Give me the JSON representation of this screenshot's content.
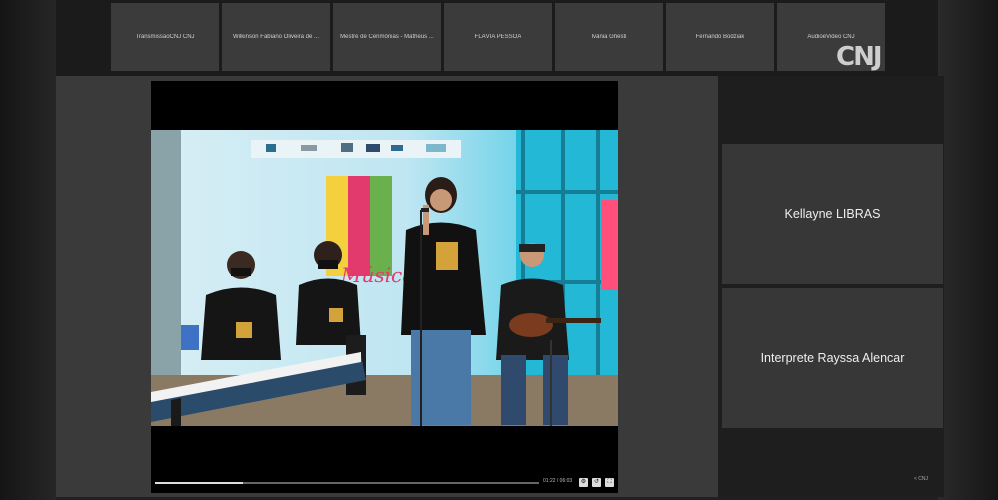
{
  "participants_strip": [
    {
      "name": "TransmissaoCNJ CNJ"
    },
    {
      "name": "Wilkinson Fabiano Oliveira de ..."
    },
    {
      "name": "Mestre de Cerimônias - Matheus ..."
    },
    {
      "name": "FLÁVIA PESSOA"
    },
    {
      "name": "Ivânia Ghesti"
    },
    {
      "name": "Fernando Bodziak"
    },
    {
      "name": "AudioeVideo CNJ"
    }
  ],
  "brand": {
    "logo_text": "CNJ"
  },
  "video": {
    "banner_text": "Música",
    "time_label": "01:22 / 06:03",
    "progress_fraction": 0.23
  },
  "side_participants": [
    {
      "name": "Kellayne LIBRAS"
    },
    {
      "name": "Interprete Rayssa Alencar"
    }
  ],
  "footer": {
    "tag": "< CNJ"
  },
  "colors": {
    "tile_bg": "#3b3b3b",
    "stage_bg": "#3a3a3a",
    "wall": "#29b6cf"
  }
}
